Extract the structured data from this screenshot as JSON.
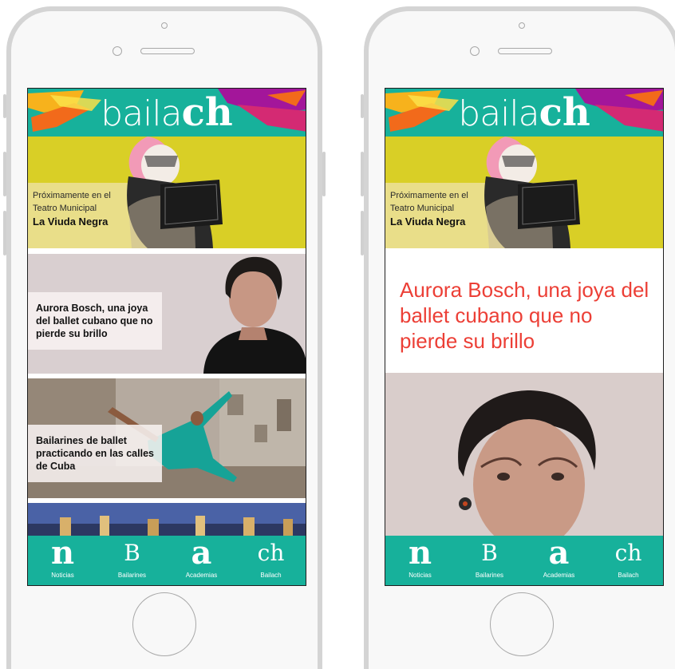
{
  "app": {
    "logo_text_light": "baila",
    "logo_text_bold": "ch"
  },
  "colors": {
    "accent": "#17b19b",
    "feature_bg": "#d9cf26",
    "headline": "#ec3f36"
  },
  "home_screen": {
    "feature": {
      "line1": "Próximamente en el",
      "line2": "Teatro Municipal",
      "title": "La Viuda Negra"
    },
    "articles": [
      {
        "title": "Aurora Bosch, una joya del ballet cubano que no pierde su brillo"
      },
      {
        "title": "Bailarines de ballet practicando en las calles de Cuba"
      }
    ]
  },
  "article_screen": {
    "feature": {
      "line1": "Próximamente en el",
      "line2": "Teatro Municipal",
      "title": "La Viuda Negra"
    },
    "headline": "Aurora Bosch, una joya del ballet cubano que no pierde su brillo"
  },
  "tabs": [
    {
      "glyph": "n",
      "label": "Noticias"
    },
    {
      "glyph": "B",
      "label": "Bailarines"
    },
    {
      "glyph": "a",
      "label": "Academias"
    },
    {
      "glyph": "ch",
      "label": "Bailach"
    }
  ]
}
